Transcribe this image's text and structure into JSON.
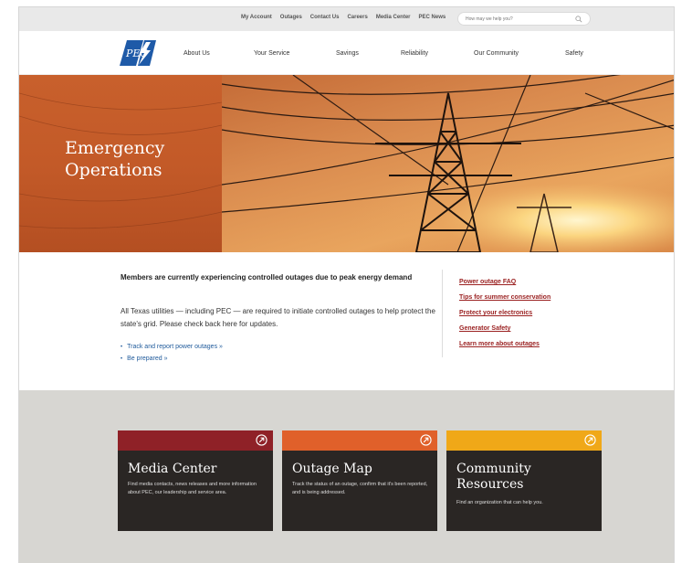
{
  "utility": {
    "links": [
      "My Account",
      "Outages",
      "Contact Us",
      "Careers",
      "Media Center",
      "PEC News"
    ],
    "search_placeholder": "How may we help you?"
  },
  "nav": {
    "logo_text": "PEC",
    "items": [
      "About Us",
      "Your Service",
      "Savings",
      "Reliability",
      "Our Community",
      "Safety"
    ]
  },
  "hero": {
    "title_line1": "Emergency",
    "title_line2": "Operations"
  },
  "alert": {
    "heading": "Members are currently experiencing controlled outages due to peak energy demand",
    "body": "All Texas utilities — including PEC — are required to initiate controlled outages to help protect the state's grid. Please check back here for updates.",
    "links": [
      "Track and report power outages »",
      "Be prepared »"
    ]
  },
  "side_links": [
    "Power outage FAQ",
    "Tips for summer conservation",
    "Protect your electronics",
    "Generator Safety",
    "Learn more about outages"
  ],
  "cards": [
    {
      "title": "Media Center",
      "description": "Find media contacts, news releases and more information about PEC, our leadership and service area.",
      "color": "#8f2127"
    },
    {
      "title": "Outage Map",
      "description": "Track the status of an outage, confirm that it's been reported, and is being addressed.",
      "color": "#e0602a"
    },
    {
      "title": "Community Resources",
      "title_line1": "Community",
      "title_line2": "Resources",
      "description": "Find an organization that can help you.",
      "color": "#f0a818"
    }
  ],
  "colors": {
    "utility_bar": "#e9e9e9",
    "hero_panel": "#c35a28",
    "link_blue": "#1f5a9b",
    "link_red": "#9b2222",
    "gray_band": "#d7d6d2",
    "card_bg": "#2a2624"
  }
}
